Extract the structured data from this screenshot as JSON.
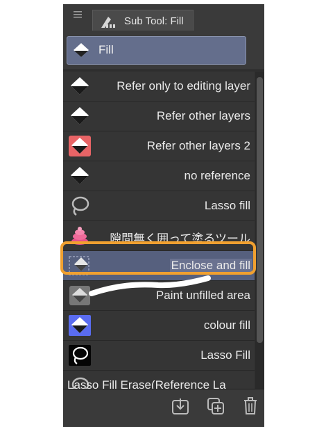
{
  "titlebar": {
    "menu_icon": "hamburger-menu-icon",
    "tab_icon": "fill-tool-icon",
    "tab_label": "Sub Tool: Fill"
  },
  "group": {
    "label": "Fill",
    "icon": "fill-bucket-icon"
  },
  "list": {
    "items": [
      {
        "label": "Refer only to editing layer",
        "icon": "fill-bucket-icon",
        "selected": false
      },
      {
        "label": "Refer other layers",
        "icon": "fill-bucket-icon",
        "selected": false
      },
      {
        "label": "Refer other layers 2",
        "icon": "fill-bucket-red-icon",
        "selected": false
      },
      {
        "label": "no reference",
        "icon": "fill-bucket-icon",
        "selected": false
      },
      {
        "label": "Lasso fill",
        "icon": "lasso-icon",
        "selected": false
      },
      {
        "label": "隙間無く囲って塗るツール",
        "icon": "pink-swirl-icon",
        "selected": false
      },
      {
        "label": "Enclose and fill",
        "icon": "enclose-fill-icon",
        "selected": true
      },
      {
        "label": "Paint unfilled area",
        "icon": "paint-unfilled-icon",
        "selected": false
      },
      {
        "label": "colour fill",
        "icon": "fill-bucket-blue-icon",
        "selected": false
      },
      {
        "label": "Lasso Fill",
        "icon": "lasso-black-icon",
        "selected": false
      },
      {
        "label": "Lasso Fill Erase(Reference La",
        "icon": "lasso-erase-icon",
        "selected": false
      }
    ]
  },
  "bottom": {
    "icons": [
      "download-icon",
      "add-copy-icon",
      "trash-icon"
    ]
  },
  "colors": {
    "panel_bg": "#2f2f2f",
    "row_bg": "#353535",
    "selected_bg": "#56607e",
    "highlight": "#f0a030"
  }
}
